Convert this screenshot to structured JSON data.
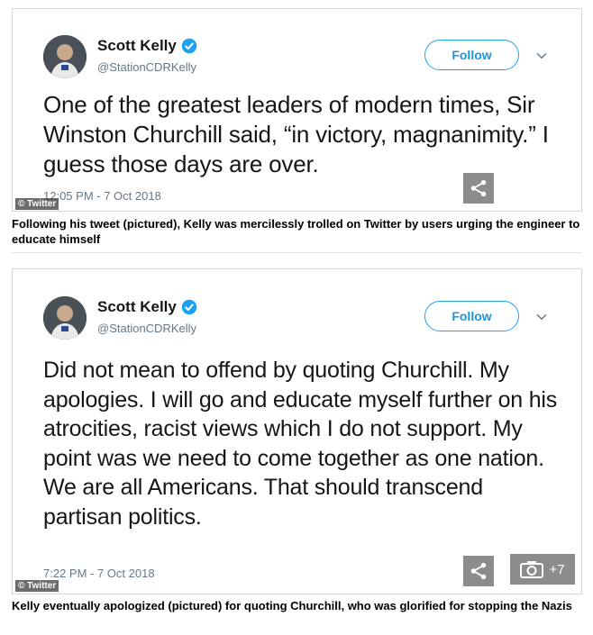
{
  "tweet1": {
    "name": "Scott Kelly",
    "handle": "@StationCDRKelly",
    "follow_label": "Follow",
    "text": "One of the greatest leaders of modern times, Sir Winston Churchill said, “in victory, magnanimity.” I guess those days are over.",
    "timestamp": "12:05 PM - 7 Oct 2018",
    "credit": "© Twitter"
  },
  "caption1": "Following his tweet (pictured), Kelly was mercilessly trolled on Twitter by users urging the engineer to educate himself",
  "tweet2": {
    "name": "Scott Kelly",
    "handle": "@StationCDRKelly",
    "follow_label": "Follow",
    "text": "Did not mean to offend by quoting Churchill. My apologies. I will go and educate myself further on his atrocities, racist views which I do not support. My point was we need to come together as one nation. We are all Americans. That should transcend partisan politics.",
    "timestamp": "7:22 PM - 7 Oct 2018",
    "credit": "© Twitter",
    "gallery_count": "+7"
  },
  "caption2": "Kelly eventually apologized (pictured) for quoting Churchill, who was glorified for stopping the Nazis",
  "colors": {
    "twitter_blue": "#1da1f2",
    "text": "#14171a",
    "muted": "#657786",
    "overlay_button": "#8c8c8c"
  },
  "icons": [
    "avatar",
    "verified-badge-icon",
    "chevron-down-icon",
    "share-icon",
    "camera-icon"
  ]
}
